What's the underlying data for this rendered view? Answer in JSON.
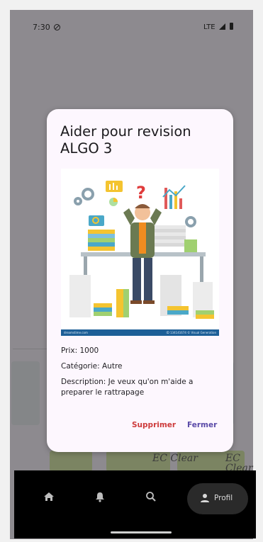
{
  "status": {
    "time": "7:30",
    "network": "LTE"
  },
  "dialog": {
    "title": "Aider pour revision ALGO 3",
    "image_credit_left": "dreamstime.com",
    "image_credit_right": "ID 134141674 © Visual Generation",
    "price": "Prix: 1000",
    "category": "Catégorie: Autre",
    "description": "Description: Je veux qu'on m'aide a preparer le rattrapage",
    "delete_label": "Supprimer",
    "close_label": "Fermer"
  },
  "background": {
    "text_left": "EC Clear",
    "text_right": "EC Clear"
  },
  "nav": {
    "items": [
      {
        "icon": "home-icon"
      },
      {
        "icon": "bell-icon"
      },
      {
        "icon": "search-icon"
      },
      {
        "icon": "person-icon",
        "label": "Profil"
      }
    ]
  },
  "colors": {
    "dialog_bg": "#fdf7fe",
    "delete": "#cd3b3b",
    "close": "#5a4aa8",
    "scrim": "#8d8a8f"
  }
}
